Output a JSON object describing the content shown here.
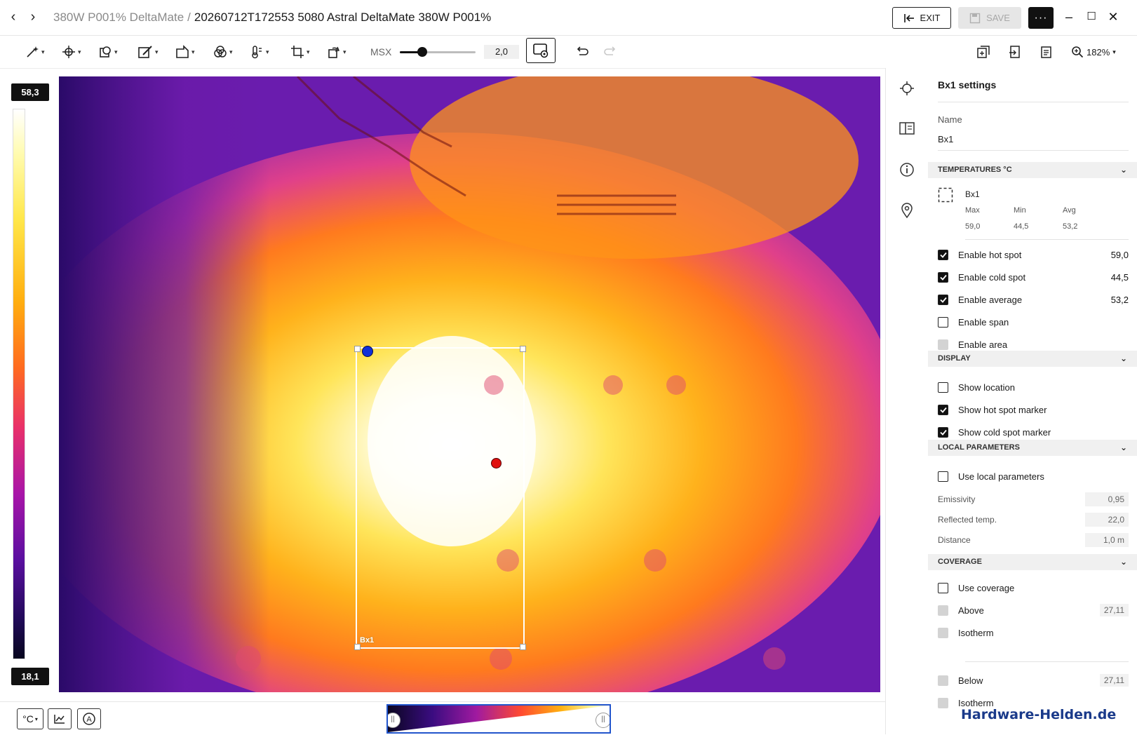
{
  "window": {
    "breadcrumb_parent": "380W P001% DeltaMate",
    "breadcrumb_separator": "/",
    "breadcrumb_current": "20260712T172553 5080 Astral DeltaMate 380W P001%",
    "exit_label": "EXIT",
    "save_label": "SAVE",
    "more_label": "···"
  },
  "toolbar": {
    "msx_label": "MSX",
    "msx_value": "2,0",
    "msx_level": 0.3,
    "zoom_label": "182%"
  },
  "scale": {
    "max": "58,3",
    "min": "18,1"
  },
  "image": {
    "roi_label": "Bx1"
  },
  "bottombar": {
    "unit_label": "°C"
  },
  "panel": {
    "title": "Bx1 settings",
    "name_label": "Name",
    "name_value": "Bx1",
    "temperatures": {
      "header": "TEMPERATURES °C",
      "box_name": "Bx1",
      "max_label": "Max",
      "min_label": "Min",
      "avg_label": "Avg",
      "max_value": "59,0",
      "min_value": "44,5",
      "avg_value": "53,2"
    },
    "options": [
      {
        "label": "Enable hot spot",
        "value": "59,0",
        "state": "checked"
      },
      {
        "label": "Enable cold spot",
        "value": "44,5",
        "state": "checked"
      },
      {
        "label": "Enable average",
        "value": "53,2",
        "state": "checked"
      },
      {
        "label": "Enable span",
        "value": "",
        "state": "unchecked"
      },
      {
        "label": "Enable area",
        "value": "",
        "state": "disabled"
      }
    ],
    "display": {
      "header": "DISPLAY",
      "items": [
        {
          "label": "Show location",
          "state": "unchecked"
        },
        {
          "label": "Show hot spot marker",
          "state": "checked"
        },
        {
          "label": "Show cold spot marker",
          "state": "checked"
        }
      ]
    },
    "local": {
      "header": "LOCAL PARAMETERS",
      "use_label": "Use local parameters",
      "emissivity_label": "Emissivity",
      "emissivity_value": "0,95",
      "reflected_label": "Reflected temp.",
      "reflected_value": "22,0",
      "distance_label": "Distance",
      "distance_value": "1,0 m"
    },
    "coverage": {
      "header": "COVERAGE",
      "use_label": "Use coverage",
      "above_label": "Above",
      "above_value": "27,11",
      "isotherm_label": "Isotherm",
      "below_label": "Below",
      "below_value": "27,11",
      "isotherm2_label": "Isotherm"
    }
  },
  "watermark": "Hardware-Helden.de",
  "colors": {
    "accent": "#111111",
    "cold_marker": "#1030d8",
    "hot_marker": "#e01010",
    "palette_border": "#2255cc"
  }
}
